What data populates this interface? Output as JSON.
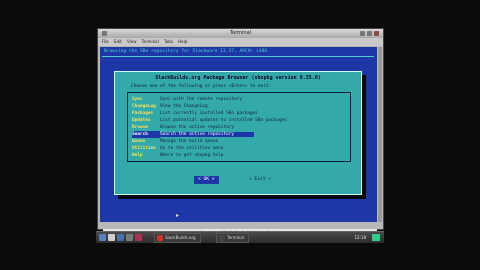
{
  "window": {
    "title": "Terminal",
    "menu": [
      "File",
      "Edit",
      "View",
      "Terminal",
      "Tabs",
      "Help"
    ]
  },
  "terminal": {
    "header": "Browsing the SBo repository for Slackware 13.37, ARCH: i486"
  },
  "dialog": {
    "title": "SlackBuilds.org Package Browser (sbopkg version 0.35.0)",
    "prompt": "Choose one of the following or press <Enter> to exit:",
    "menu": [
      {
        "key": "Sync",
        "desc": "Sync with the remote repository"
      },
      {
        "key": "ChangeLog",
        "desc": "View the ChangeLog"
      },
      {
        "key": "Packages",
        "desc": "List currently installed SBo packages"
      },
      {
        "key": "Updates",
        "desc": "List potential updates to installed SBo packages"
      },
      {
        "key": "Browse",
        "desc": "Browse the active repository"
      },
      {
        "key": "Search",
        "desc": "Search the active repository"
      },
      {
        "key": "Queue",
        "desc": "Manage the build queue"
      },
      {
        "key": "Utilities",
        "desc": "Go to the utilities menu"
      },
      {
        "key": "Help",
        "desc": "Where to get sbopkg help"
      }
    ],
    "selected_index": 5,
    "ok_label": "< OK >",
    "cancel_label": "< Exit >"
  },
  "page_strip": {
    "label": "Homepage:",
    "link": "http://wiki.slackbuilds.org/sbopkg"
  },
  "taskbar": {
    "tasks": [
      "SlackBuilds.org",
      "Terminal"
    ],
    "clock": "12:18"
  },
  "colors": {
    "terminal_bg": "#1d37a6",
    "dialog_bg": "#34a9a9",
    "menu_key": "#ffe25a"
  }
}
